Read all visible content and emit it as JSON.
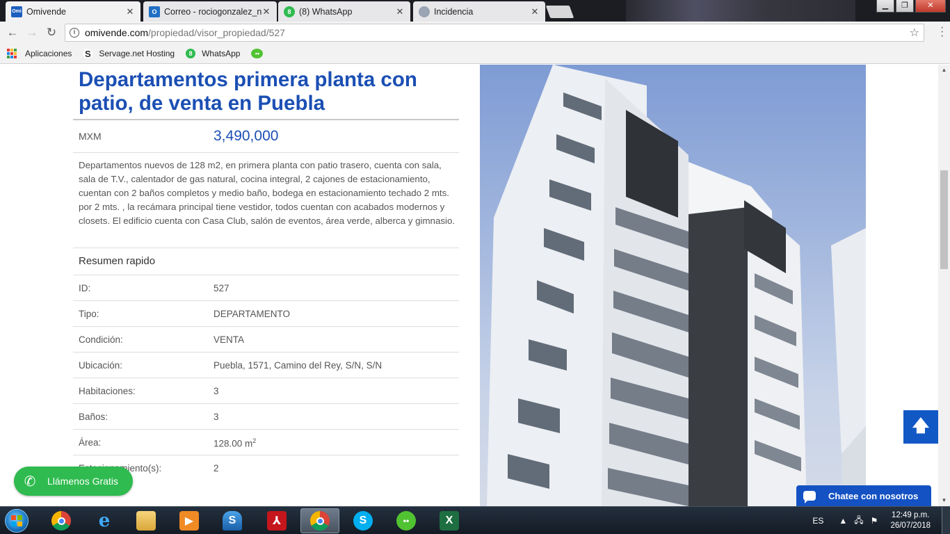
{
  "browser": {
    "tabs": [
      {
        "label": "Omivende",
        "icon": "omivende-icon",
        "fav_text": "Omi",
        "fav_color": "#1d5fbf",
        "active": true
      },
      {
        "label": "Correo - rociogonzalez_n",
        "icon": "outlook-icon",
        "fav_text": "O",
        "fav_color": "#1f6fc4",
        "active": false
      },
      {
        "label": "(8) WhatsApp",
        "icon": "whatsapp-icon",
        "fav_text": "8",
        "fav_color": "#2fbb4f",
        "active": false
      },
      {
        "label": "Incidencia",
        "icon": "page-icon",
        "fav_text": "",
        "fav_color": "#9aa4b2",
        "active": false
      }
    ],
    "address": {
      "host": "omivende.com",
      "path": "/propiedad/visor_propiedad/527"
    },
    "bookmarks": [
      {
        "label": "Aplicaciones",
        "icon": "apps-grid-icon"
      },
      {
        "label": "Servage.net Hosting",
        "icon": "servage-icon"
      },
      {
        "label": "WhatsApp",
        "icon": "whatsapp-icon"
      },
      {
        "label": "",
        "icon": "wechat-icon"
      }
    ]
  },
  "property": {
    "title": "Departamentos primera planta con patio, de venta en Puebla",
    "currency": "MXM",
    "price": "3,490,000",
    "description": "Departamentos nuevos de 128 m2, en primera planta con patio trasero, cuenta con sala, sala de T.V., calentador de gas natural, cocina integral, 2 cajones de estacionamiento, cuentan con 2 baños completos y medio baño, bodega en estacionamiento techado 2 mts. por 2 mts. , la recámara principal tiene vestidor, todos cuentan con acabados modernos y closets. El edificio cuenta con Casa Club, salón de eventos, área verde, alberca y gimnasio.",
    "summary_title": "Resumen rapido",
    "summary": [
      {
        "key": "ID:",
        "value": "527"
      },
      {
        "key": "Tipo:",
        "value": "DEPARTAMENTO"
      },
      {
        "key": "Condición:",
        "value": "VENTA"
      },
      {
        "key": "Ubicación:",
        "value": "Puebla, 1571, Camino del Rey, S/N, S/N"
      },
      {
        "key": "Habitaciones:",
        "value": "3"
      },
      {
        "key": "Baños:",
        "value": "3"
      },
      {
        "key": "Área:",
        "value": "128.00 m",
        "sup": "2"
      },
      {
        "key": "Estacionamiento(s):",
        "value": "2"
      }
    ]
  },
  "widgets": {
    "call_label": "Llámenos Gratis",
    "chat_label": "Chatee con nosotros",
    "scroll_top_icon": "arrow-up-icon"
  },
  "taskbar": {
    "apps": [
      "chrome-icon",
      "internet-explorer-icon",
      "file-explorer-icon",
      "media-player-icon",
      "sky-app-icon",
      "acrobat-icon",
      "chrome-icon",
      "skype-icon",
      "wechat-icon",
      "excel-icon"
    ],
    "language": "ES",
    "time": "12:49 p.m.",
    "date": "26/07/2018"
  },
  "colors": {
    "title_blue": "#1b4fb4",
    "button_blue": "#1258c5",
    "call_green": "#2fbb4f"
  }
}
